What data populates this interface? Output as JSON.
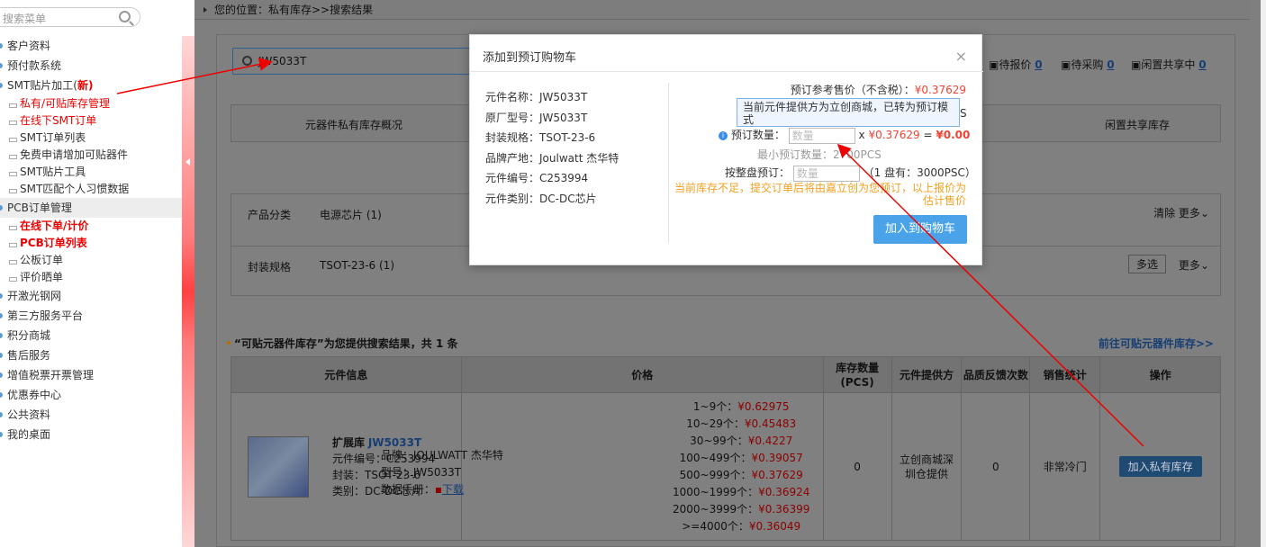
{
  "sidebar": {
    "search_placeholder": "搜索菜单",
    "items": [
      {
        "label": "客户资料",
        "type": "top"
      },
      {
        "label": "预付款系统",
        "type": "top"
      },
      {
        "label": "SMT贴片加工(",
        "badge": "新",
        "type": "top",
        "after": ")"
      },
      {
        "label": "私有/可贴库存管理",
        "type": "sub-red"
      },
      {
        "label": "在线下SMT订单",
        "type": "sub-red"
      },
      {
        "label": "SMT订单列表",
        "type": "sub"
      },
      {
        "label": "免费申请增加可贴器件",
        "type": "sub"
      },
      {
        "label": "SMT贴片工具",
        "type": "sub"
      },
      {
        "label": "SMT匹配个人习惯数据",
        "type": "sub"
      },
      {
        "label": "PCB订单管理",
        "type": "top-grey"
      },
      {
        "label": "在线下单/计价",
        "type": "sub-bold"
      },
      {
        "label": "PCB订单列表",
        "type": "sub-bold"
      },
      {
        "label": "公板订单",
        "type": "sub"
      },
      {
        "label": "评价晒单",
        "type": "sub"
      },
      {
        "label": "开激光钢网",
        "type": "top"
      },
      {
        "label": "第三方服务平台",
        "type": "top"
      },
      {
        "label": "积分商城",
        "type": "top"
      },
      {
        "label": "售后服务",
        "type": "top"
      },
      {
        "label": "增值税票开票管理",
        "type": "top"
      },
      {
        "label": "优惠券中心",
        "type": "top"
      },
      {
        "label": "公共资料",
        "type": "top"
      },
      {
        "label": "我的桌面",
        "type": "top"
      }
    ]
  },
  "breadcrumb": "您的位置：私有库存>>搜索结果",
  "search": {
    "value": "JW5033T"
  },
  "stats": [
    {
      "label": "待报价",
      "count": "0"
    },
    {
      "label": "待采购",
      "count": "0"
    },
    {
      "label": "闲置共享中",
      "count": "0"
    }
  ],
  "tabs": [
    "元器件私有库存概况",
    "闲置共享库存"
  ],
  "filters": {
    "category_key": "产品分类",
    "category_val": "电源芯片 (1)",
    "package_key": "封装规格",
    "package_val": "TSOT-23-6 (1)",
    "clear": "清除",
    "more": "更多",
    "multi": "多选"
  },
  "result": {
    "heading": "“可贴元器件库存”为您提供搜索结果，共 1 条",
    "goto": "前往可贴元器件库存>>"
  },
  "table": {
    "headers": [
      "元件信息",
      "价格",
      "库存数量(PCS)",
      "元件提供方",
      "品质反馈次数",
      "销售统计",
      "操作"
    ],
    "row": {
      "lib": "扩展库",
      "name": "JW5033T",
      "code": "元件编号：C253994",
      "pkg": "封装：TSOT-23-6",
      "cat": "类别：DC-DC芯片",
      "brand": "品牌：JOULWATT 杰华特",
      "model": "型号：JW5033T",
      "datasheet_label": "数据手册：",
      "datasheet_link": "下载",
      "prices": [
        {
          "range": "1~9个：",
          "price": "¥0.62975"
        },
        {
          "range": "10~29个：",
          "price": "¥0.45483"
        },
        {
          "range": "30~99个：",
          "price": "¥0.4227"
        },
        {
          "range": "100~499个：",
          "price": "¥0.39057"
        },
        {
          "range": "500~999个：",
          "price": "¥0.37629"
        },
        {
          "range": "1000~1999个：",
          "price": "¥0.36924"
        },
        {
          "range": "2000~3999个：",
          "price": "¥0.36399"
        },
        {
          "range": ">=4000个：",
          "price": "¥0.36049"
        }
      ],
      "stock": "0",
      "provider": "立创商城深圳仓提供",
      "feedback": "0",
      "sales": "非常冷门",
      "action": "加入私有库存"
    }
  },
  "modal": {
    "title": "添加到预订购物车",
    "close": "×",
    "fields": [
      "元件名称：JW5033T",
      "原厂型号：JW5033T",
      "封装规格：TSOT-23-6",
      "品牌产地：Joulwatt 杰华特",
      "元件编号：C253994",
      "元件类别：DC-DC芯片"
    ],
    "ref_price_label": "预订参考售价（不含税）：",
    "ref_price": "¥0.37629",
    "tooltip": "当前元件提供方为立创商城，已转为预订模式",
    "tooltip_tail": "S",
    "qty_label": "预订数量：",
    "qty_placeholder": "数量",
    "times": "x",
    "unit_price": "¥0.37629",
    "equals": "=",
    "total": "¥0.00",
    "min_qty": "最小预订数量：2700PCS",
    "reel_label": "按整盘预订：",
    "reel_placeholder": "数量",
    "reel_info": "（1 盘有：3000PSC）",
    "warning": "当前库存不足，提交订单后将由嘉立创为您预订，以上报价为估计售价",
    "add_button": "加入到购物车"
  }
}
